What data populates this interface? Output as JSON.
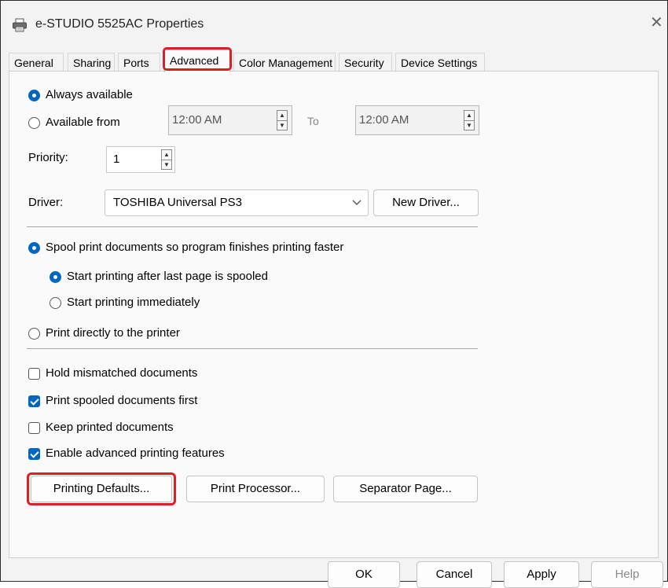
{
  "window": {
    "title": "e-STUDIO 5525AC Properties",
    "close_glyph": "✕"
  },
  "tabs": [
    "General",
    "Sharing",
    "Ports",
    "Advanced",
    "Color Management",
    "Security",
    "Device Settings"
  ],
  "active_tab": "Advanced",
  "availability": {
    "always_label": "Always available",
    "from_label": "Available from",
    "selected": "always",
    "from_time": "12:00 AM",
    "to_label": "To",
    "to_time": "12:00 AM"
  },
  "priority": {
    "label": "Priority:",
    "value": "1"
  },
  "driver": {
    "label": "Driver:",
    "value": "TOSHIBA Universal PS3",
    "new_driver_button": "New Driver..."
  },
  "spooling": {
    "spool_label": "Spool print documents so program finishes printing faster",
    "after_last_label": "Start printing after last page is spooled",
    "immediately_label": "Start printing immediately",
    "direct_label": "Print directly to the printer"
  },
  "options": {
    "hold_mismatched": {
      "label": "Hold mismatched documents",
      "checked": false
    },
    "spooled_first": {
      "label": "Print spooled documents first",
      "checked": true
    },
    "keep_printed": {
      "label": "Keep printed documents",
      "checked": false
    },
    "advanced_features": {
      "label": "Enable advanced printing features",
      "checked": true
    }
  },
  "panel_buttons": {
    "printing_defaults": "Printing Defaults...",
    "print_processor": "Print Processor...",
    "separator_page": "Separator Page..."
  },
  "footer": {
    "ok": "OK",
    "cancel": "Cancel",
    "apply": "Apply",
    "help": "Help"
  },
  "colors": {
    "accent": "#0067c0",
    "highlight": "#d92027"
  },
  "icons": {
    "title_icon": "printer-icon",
    "spin_up": "▲",
    "spin_down": "▼",
    "dropdown": "chevron-down-icon"
  }
}
